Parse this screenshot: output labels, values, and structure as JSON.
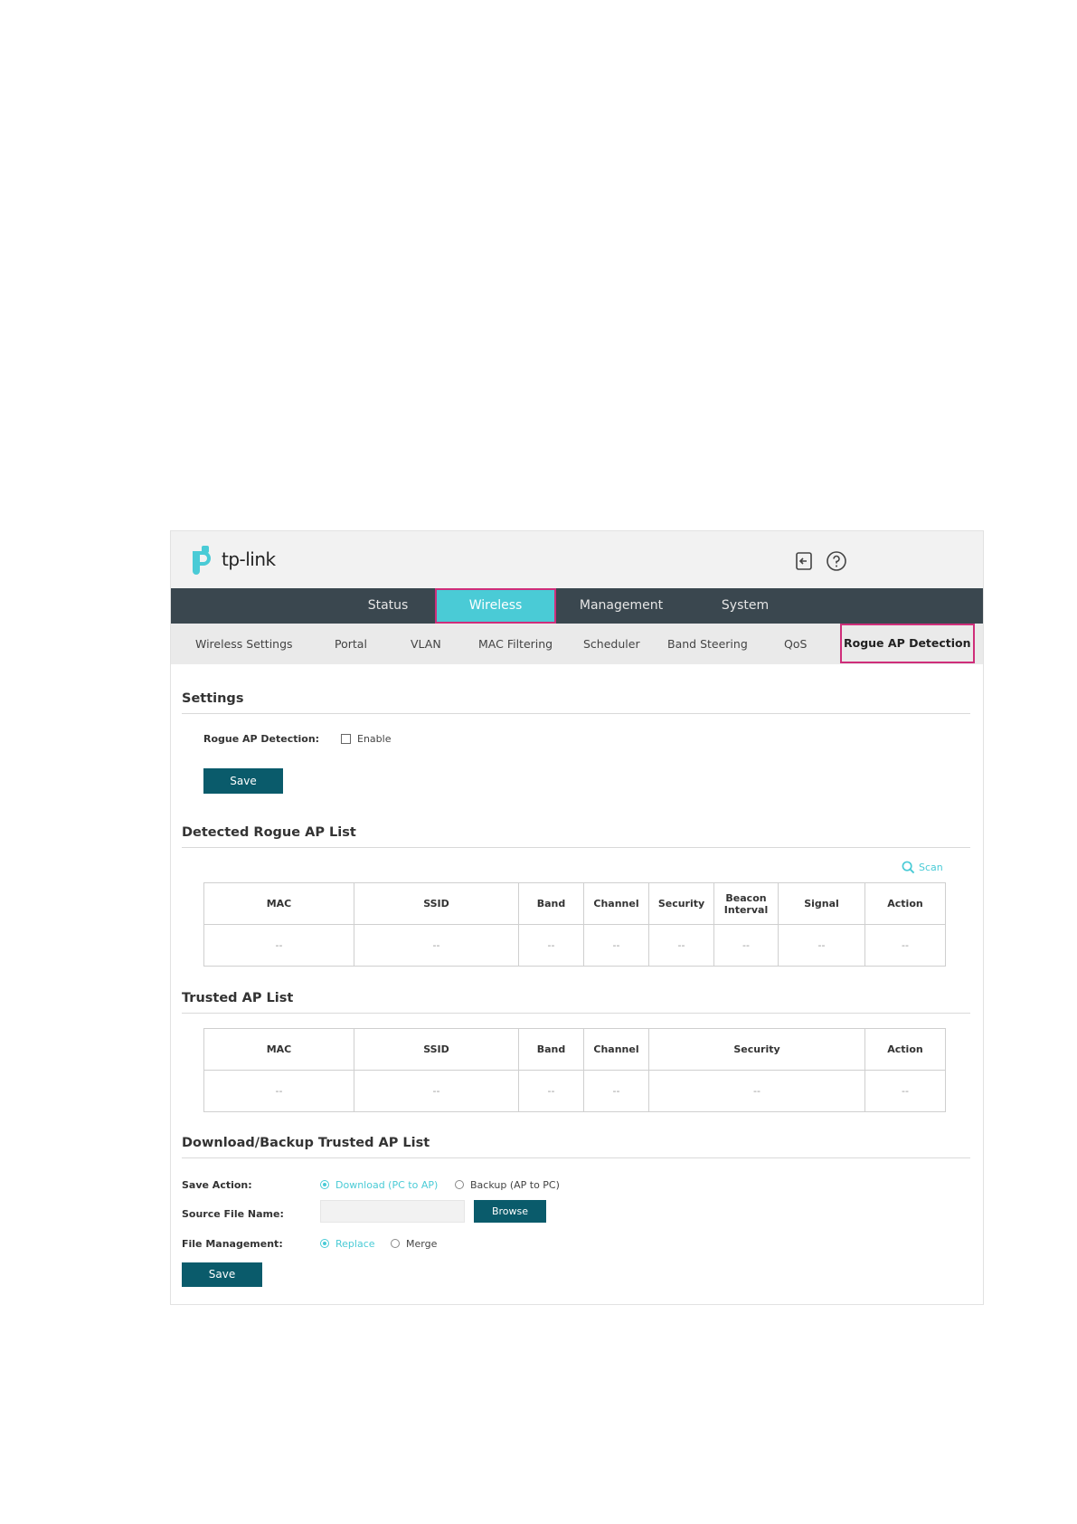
{
  "header": {
    "brand": "tp-link"
  },
  "main_nav": {
    "items": [
      "Status",
      "Wireless",
      "Management",
      "System"
    ]
  },
  "sub_nav": {
    "items": [
      "Wireless Settings",
      "Portal",
      "VLAN",
      "MAC Filtering",
      "Scheduler",
      "Band Steering",
      "QoS",
      "Rogue AP Detection"
    ]
  },
  "settings": {
    "title": "Settings",
    "rogue_label": "Rogue AP Detection:",
    "enable_label": "Enable",
    "enable_checked": false,
    "save_label": "Save"
  },
  "detected": {
    "title": "Detected Rogue AP List",
    "scan_label": "Scan",
    "headers": [
      "MAC",
      "SSID",
      "Band",
      "Channel",
      "Security",
      "Beacon Interval",
      "Signal",
      "Action"
    ],
    "row": [
      "--",
      "--",
      "--",
      "--",
      "--",
      "--",
      "--",
      "--"
    ]
  },
  "trusted": {
    "title": "Trusted AP List",
    "headers": [
      "MAC",
      "SSID",
      "Band",
      "Channel",
      "Security",
      "Action"
    ],
    "row": [
      "--",
      "--",
      "--",
      "--",
      "--",
      "--"
    ]
  },
  "download": {
    "title": "Download/Backup Trusted AP List",
    "save_action_label": "Save Action:",
    "download_option": "Download (PC to AP)",
    "backup_option": "Backup (AP to PC)",
    "source_file_label": "Source File Name:",
    "source_file_value": "",
    "browse_label": "Browse",
    "file_management_label": "File Management:",
    "replace_option": "Replace",
    "merge_option": "Merge",
    "save_label": "Save"
  },
  "colors": {
    "accent": "#4acbd6",
    "nav_bg": "#3a474f",
    "button": "#0a5b6b",
    "highlight": "#cf2e7a"
  }
}
